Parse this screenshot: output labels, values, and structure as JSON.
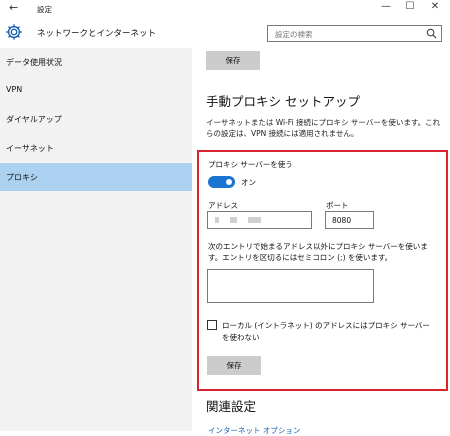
{
  "window": {
    "title": "設定",
    "back_glyph": "←",
    "minimize_glyph": "—",
    "maximize_glyph": "☐",
    "close_glyph": "✕"
  },
  "header": {
    "title": "ネットワークとインターネット",
    "search_placeholder": "設定の検索"
  },
  "sidebar": {
    "items": [
      {
        "label": "データ使用状況",
        "active": false
      },
      {
        "label": "VPN",
        "active": false
      },
      {
        "label": "ダイヤルアップ",
        "active": false
      },
      {
        "label": "イーサネット",
        "active": false
      },
      {
        "label": "プロキシ",
        "active": true
      }
    ]
  },
  "main": {
    "top_save_label": "保存",
    "manual_heading": "手動プロキシ セットアップ",
    "description": "イーサネットまたは Wi-Fi 接続にプロキシ サーバーを使います。これらの設定は、VPN 接続には適用されません。",
    "proxy": {
      "use_proxy_label": "プロキシ サーバーを使う",
      "toggle_state": "オン",
      "toggle_on": true,
      "address_label": "アドレス",
      "port_label": "ポート",
      "port_value": "8080",
      "exceptions_label": "次のエントリで始まるアドレス以外にプロキシ サーバーを使います。エントリを区切るにはセミコロン (;) を使います。",
      "exceptions_value": "",
      "bypass_local_label": "ローカル (イントラネット) のアドレスにはプロキシ サーバーを使わない",
      "bypass_local_checked": false,
      "save_label": "保存"
    },
    "related_heading": "関連設定",
    "related_link": "インターネット オプション"
  },
  "colors": {
    "accent": "#1a75d2",
    "sidebar_bg": "#f2f2f2",
    "active_item": "#abd0f0",
    "highlight_box": "#d9262e",
    "button_bg": "#cccccc"
  }
}
